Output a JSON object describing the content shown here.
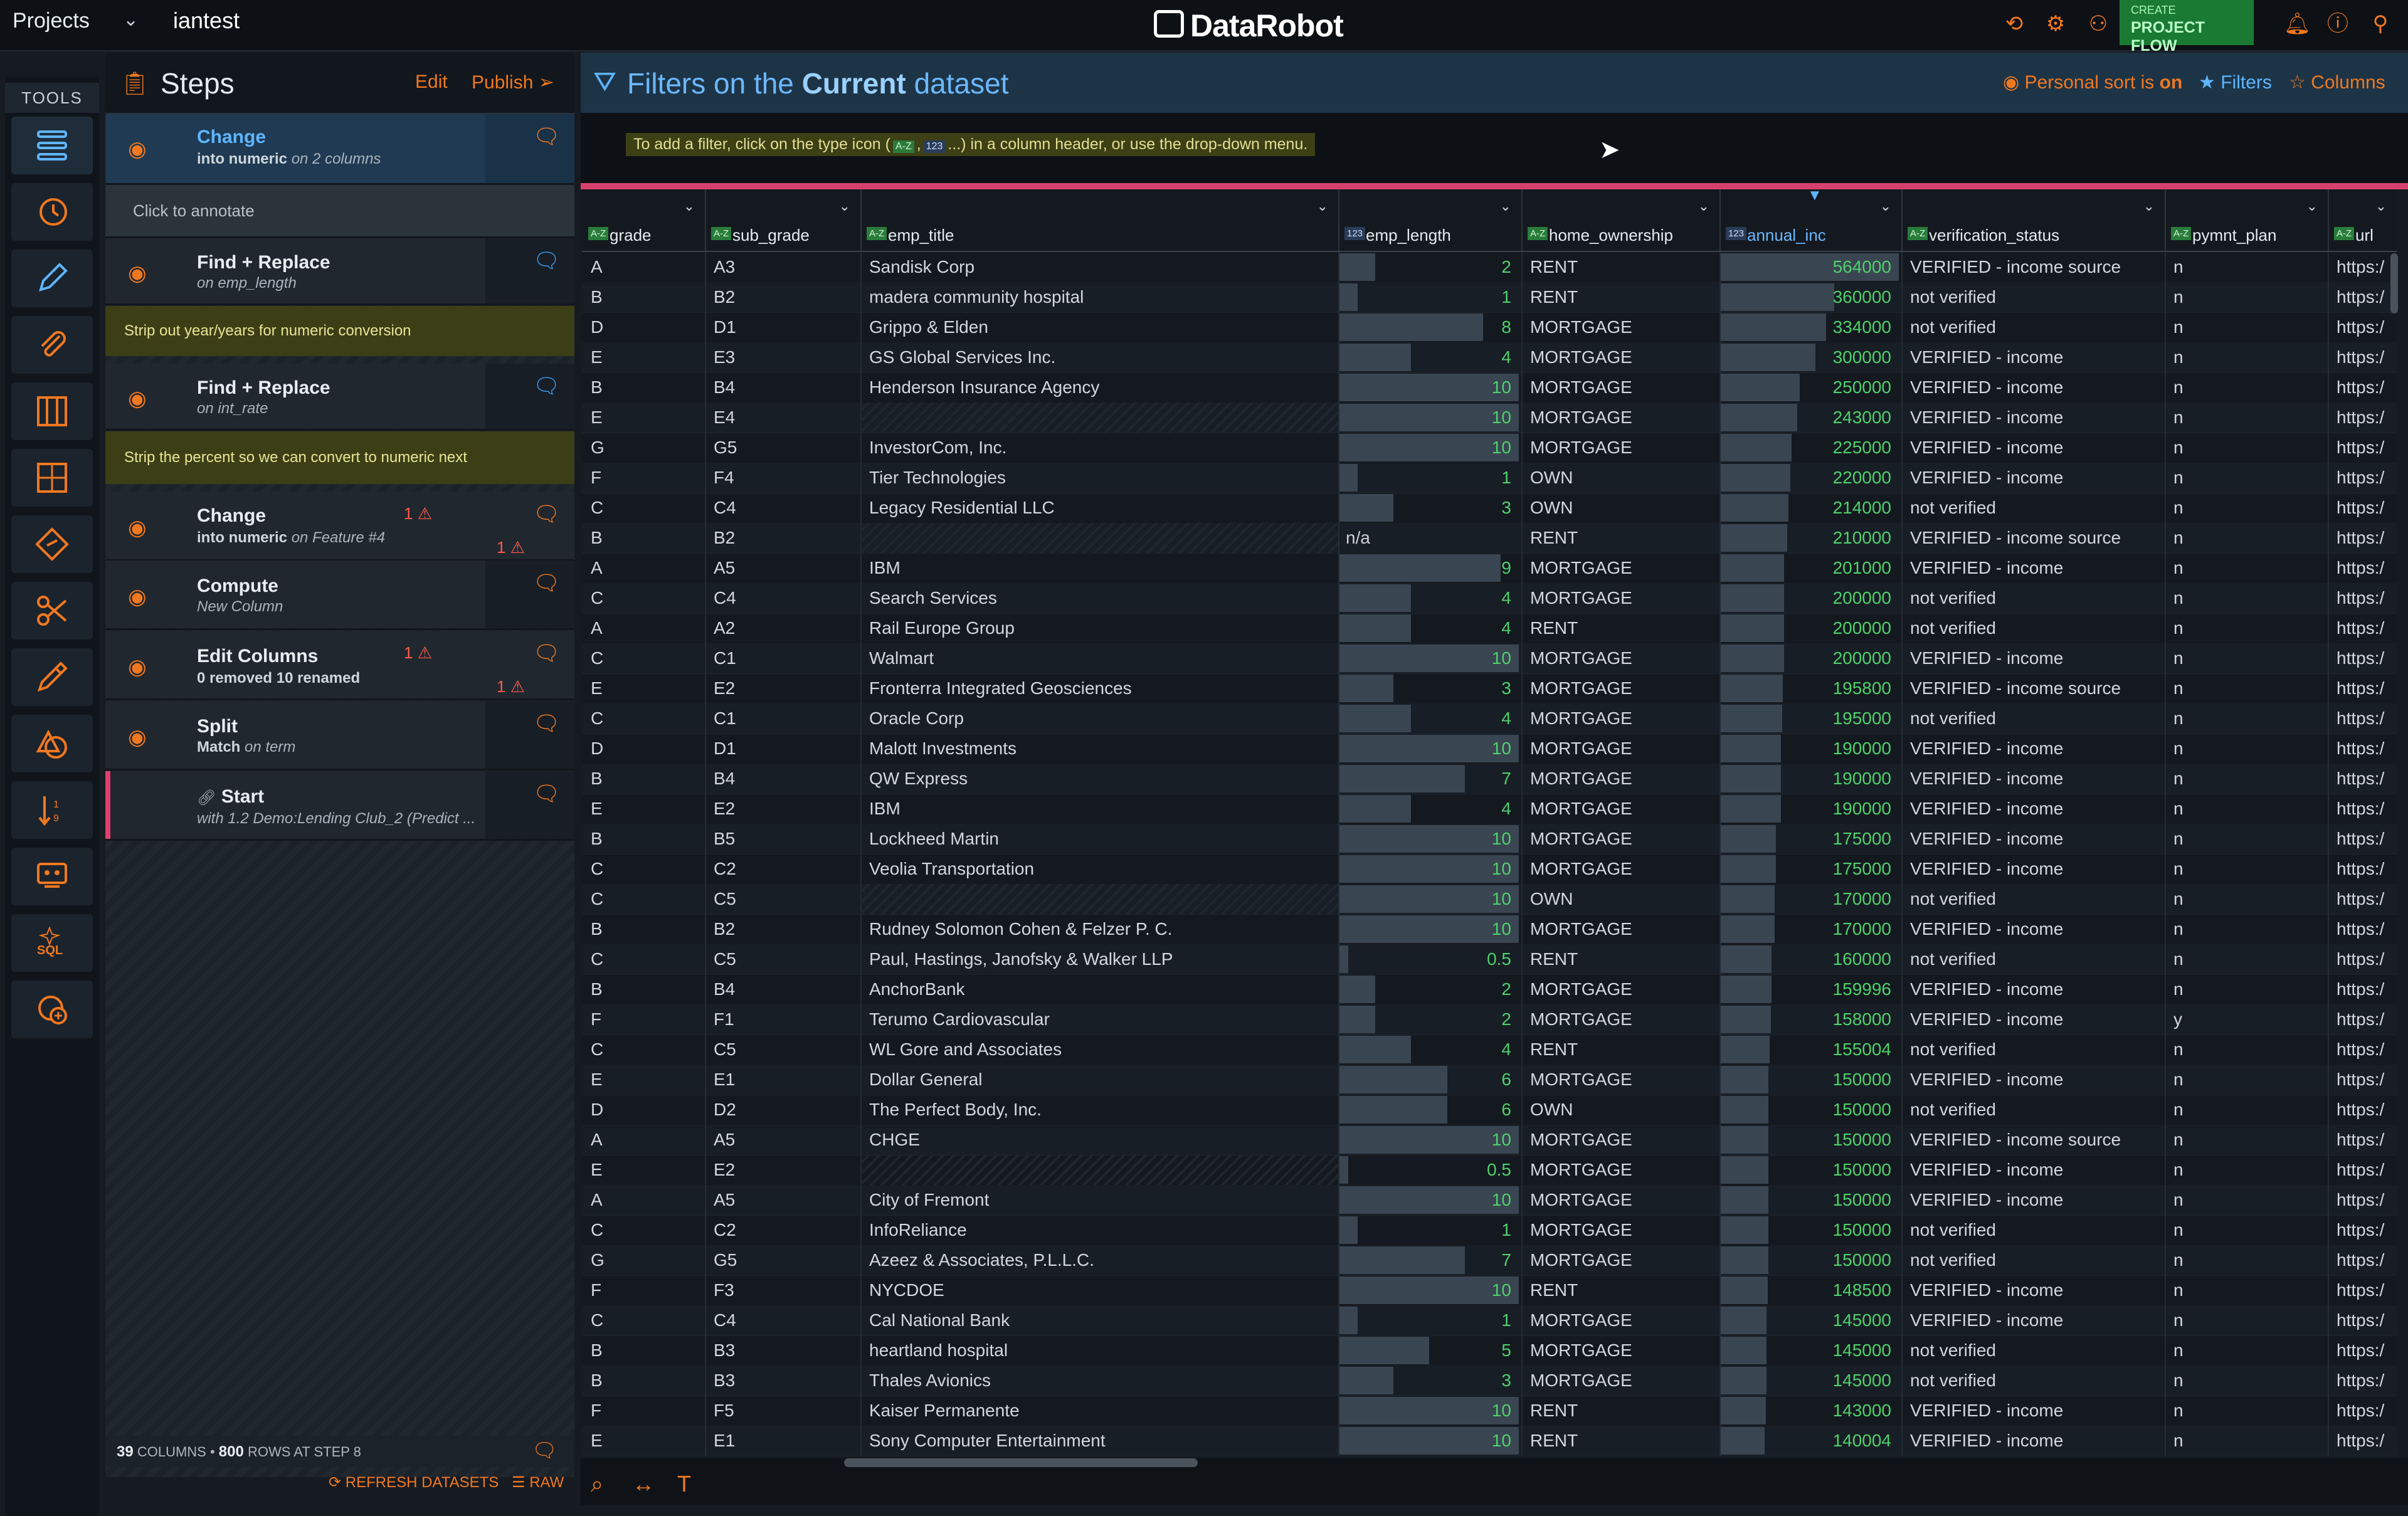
{
  "header": {
    "projects_label": "Projects",
    "project_name": "iantest",
    "logo_text": "DataRobot",
    "create_small": "CREATE",
    "create_big": "PROJECT FLOW"
  },
  "tools": {
    "label": "TOOLS"
  },
  "steps": {
    "title": "Steps",
    "edit": "Edit",
    "publish": "Publish",
    "items": [
      {
        "name": "Change",
        "sub": "into numeric",
        "sub_em": "on 2 columns"
      },
      {
        "name": "Find + Replace",
        "sub_em": "on emp_length"
      },
      {
        "name": "Find + Replace",
        "sub_em": "on int_rate"
      },
      {
        "name": "Change",
        "sub": "into numeric",
        "sub_em": "on Feature #4",
        "warn_top": "1",
        "warn_bottom": "1"
      },
      {
        "name": "Compute",
        "sub_em": "New Column"
      },
      {
        "name": "Edit Columns",
        "sub": "0 removed 10 renamed",
        "warn_top": "1",
        "warn_bottom": "1"
      },
      {
        "name": "Split",
        "sub": "Match",
        "sub_em": "on term"
      },
      {
        "name": "Start",
        "sub_em": "with 1.2 Demo:Lending Club_2 (Predict ..."
      }
    ],
    "click_annotate": "Click to annotate",
    "annot1": "Strip out year/years for numeric conversion",
    "annot2": "Strip the percent so we can convert to numeric next",
    "footer_cols": "39",
    "footer_cols_label": "COLUMNS •",
    "footer_rows": "800",
    "footer_rows_label": "ROWS AT STEP 8",
    "refresh": "REFRESH DATASETS",
    "raw": "RAW"
  },
  "filterbar": {
    "title_pre": "Filters on the",
    "title_bold": "Current",
    "title_post": "dataset",
    "personal_sort": "Personal sort is",
    "personal_sort_state": "on",
    "filters": "Filters",
    "columns": "Columns"
  },
  "hint": {
    "pre": "To add a filter, click on the type icon (",
    "mid": ",",
    "post": "...) in a column header, or use the drop-down menu.",
    "tag_text": "A-Z",
    "tag_num": "123"
  },
  "columns": [
    {
      "name": "grade",
      "type": "A-Z"
    },
    {
      "name": "sub_grade",
      "type": "A-Z"
    },
    {
      "name": "emp_title",
      "type": "A-Z"
    },
    {
      "name": "emp_length",
      "type": "123"
    },
    {
      "name": "home_ownership",
      "type": "A-Z"
    },
    {
      "name": "annual_inc",
      "type": "123"
    },
    {
      "name": "verification_status",
      "type": "A-Z"
    },
    {
      "name": "pymnt_plan",
      "type": "A-Z"
    },
    {
      "name": "url",
      "type": "A-Z"
    }
  ],
  "rows": [
    [
      "A",
      "A3",
      "Sandisk Corp",
      "2",
      "RENT",
      "564000",
      "VERIFIED - income source",
      "n",
      "https:/"
    ],
    [
      "B",
      "B2",
      "madera community hospital",
      "1",
      "RENT",
      "360000",
      "not verified",
      "n",
      "https:/"
    ],
    [
      "D",
      "D1",
      "Grippo & Elden",
      "8",
      "MORTGAGE",
      "334000",
      "not verified",
      "n",
      "https:/"
    ],
    [
      "E",
      "E3",
      "GS Global Services Inc.",
      "4",
      "MORTGAGE",
      "300000",
      "VERIFIED - income",
      "n",
      "https:/"
    ],
    [
      "B",
      "B4",
      "Henderson Insurance Agency",
      "10",
      "MORTGAGE",
      "250000",
      "VERIFIED - income",
      "n",
      "https:/"
    ],
    [
      "E",
      "E4",
      "",
      "10",
      "MORTGAGE",
      "243000",
      "VERIFIED - income",
      "n",
      "https:/"
    ],
    [
      "G",
      "G5",
      "InvestorCom, Inc.",
      "10",
      "MORTGAGE",
      "225000",
      "VERIFIED - income",
      "n",
      "https:/"
    ],
    [
      "F",
      "F4",
      "Tier Technologies",
      "1",
      "OWN",
      "220000",
      "VERIFIED - income",
      "n",
      "https:/"
    ],
    [
      "C",
      "C4",
      "Legacy Residential LLC",
      "3",
      "OWN",
      "214000",
      "not verified",
      "n",
      "https:/"
    ],
    [
      "B",
      "B2",
      "",
      "n/a",
      "RENT",
      "210000",
      "VERIFIED - income source",
      "n",
      "https:/"
    ],
    [
      "A",
      "A5",
      "IBM",
      "9",
      "MORTGAGE",
      "201000",
      "VERIFIED - income",
      "n",
      "https:/"
    ],
    [
      "C",
      "C4",
      "Search Services",
      "4",
      "MORTGAGE",
      "200000",
      "not verified",
      "n",
      "https:/"
    ],
    [
      "A",
      "A2",
      "Rail Europe Group",
      "4",
      "RENT",
      "200000",
      "not verified",
      "n",
      "https:/"
    ],
    [
      "C",
      "C1",
      "Walmart",
      "10",
      "MORTGAGE",
      "200000",
      "VERIFIED - income",
      "n",
      "https:/"
    ],
    [
      "E",
      "E2",
      "Fronterra Integrated Geosciences",
      "3",
      "MORTGAGE",
      "195800",
      "VERIFIED - income source",
      "n",
      "https:/"
    ],
    [
      "C",
      "C1",
      "Oracle Corp",
      "4",
      "MORTGAGE",
      "195000",
      "not verified",
      "n",
      "https:/"
    ],
    [
      "D",
      "D1",
      "Malott Investments",
      "10",
      "MORTGAGE",
      "190000",
      "VERIFIED - income",
      "n",
      "https:/"
    ],
    [
      "B",
      "B4",
      "QW Express",
      "7",
      "MORTGAGE",
      "190000",
      "VERIFIED - income",
      "n",
      "https:/"
    ],
    [
      "E",
      "E2",
      "IBM",
      "4",
      "MORTGAGE",
      "190000",
      "VERIFIED - income",
      "n",
      "https:/"
    ],
    [
      "B",
      "B5",
      "Lockheed Martin",
      "10",
      "MORTGAGE",
      "175000",
      "VERIFIED - income",
      "n",
      "https:/"
    ],
    [
      "C",
      "C2",
      "Veolia Transportation",
      "10",
      "MORTGAGE",
      "175000",
      "VERIFIED - income",
      "n",
      "https:/"
    ],
    [
      "C",
      "C5",
      "",
      "10",
      "OWN",
      "170000",
      "not verified",
      "n",
      "https:/"
    ],
    [
      "B",
      "B2",
      "Rudney Solomon Cohen & Felzer P. C.",
      "10",
      "MORTGAGE",
      "170000",
      "VERIFIED - income",
      "n",
      "https:/"
    ],
    [
      "C",
      "C5",
      "Paul, Hastings, Janofsky & Walker LLP",
      "0.5",
      "RENT",
      "160000",
      "not verified",
      "n",
      "https:/"
    ],
    [
      "B",
      "B4",
      "AnchorBank",
      "2",
      "MORTGAGE",
      "159996",
      "VERIFIED - income",
      "n",
      "https:/"
    ],
    [
      "F",
      "F1",
      "Terumo Cardiovascular",
      "2",
      "MORTGAGE",
      "158000",
      "VERIFIED - income",
      "y",
      "https:/"
    ],
    [
      "C",
      "C5",
      "WL Gore and Associates",
      "4",
      "RENT",
      "155004",
      "not verified",
      "n",
      "https:/"
    ],
    [
      "E",
      "E1",
      "Dollar General",
      "6",
      "MORTGAGE",
      "150000",
      "VERIFIED - income",
      "n",
      "https:/"
    ],
    [
      "D",
      "D2",
      "The Perfect Body, Inc.",
      "6",
      "OWN",
      "150000",
      "not verified",
      "n",
      "https:/"
    ],
    [
      "A",
      "A5",
      "CHGE",
      "10",
      "MORTGAGE",
      "150000",
      "VERIFIED - income source",
      "n",
      "https:/"
    ],
    [
      "E",
      "E2",
      "",
      "0.5",
      "MORTGAGE",
      "150000",
      "VERIFIED - income",
      "n",
      "https:/"
    ],
    [
      "A",
      "A5",
      "City of Fremont",
      "10",
      "MORTGAGE",
      "150000",
      "VERIFIED - income",
      "n",
      "https:/"
    ],
    [
      "C",
      "C2",
      "InfoReliance",
      "1",
      "MORTGAGE",
      "150000",
      "not verified",
      "n",
      "https:/"
    ],
    [
      "G",
      "G5",
      "Azeez & Associates, P.L.L.C.",
      "7",
      "MORTGAGE",
      "150000",
      "not verified",
      "n",
      "https:/"
    ],
    [
      "F",
      "F3",
      "NYCDOE",
      "10",
      "RENT",
      "148500",
      "VERIFIED - income",
      "n",
      "https:/"
    ],
    [
      "C",
      "C4",
      "Cal National Bank",
      "1",
      "MORTGAGE",
      "145000",
      "VERIFIED - income",
      "n",
      "https:/"
    ],
    [
      "B",
      "B3",
      "heartland hospital",
      "5",
      "MORTGAGE",
      "145000",
      "not verified",
      "n",
      "https:/"
    ],
    [
      "B",
      "B3",
      "Thales Avionics",
      "3",
      "MORTGAGE",
      "145000",
      "not verified",
      "n",
      "https:/"
    ],
    [
      "F",
      "F5",
      "Kaiser Permanente",
      "10",
      "RENT",
      "143000",
      "VERIFIED - income",
      "n",
      "https:/"
    ],
    [
      "E",
      "E1",
      "Sony Computer Entertainment",
      "10",
      "RENT",
      "140004",
      "VERIFIED - income",
      "n",
      "https:/"
    ]
  ]
}
